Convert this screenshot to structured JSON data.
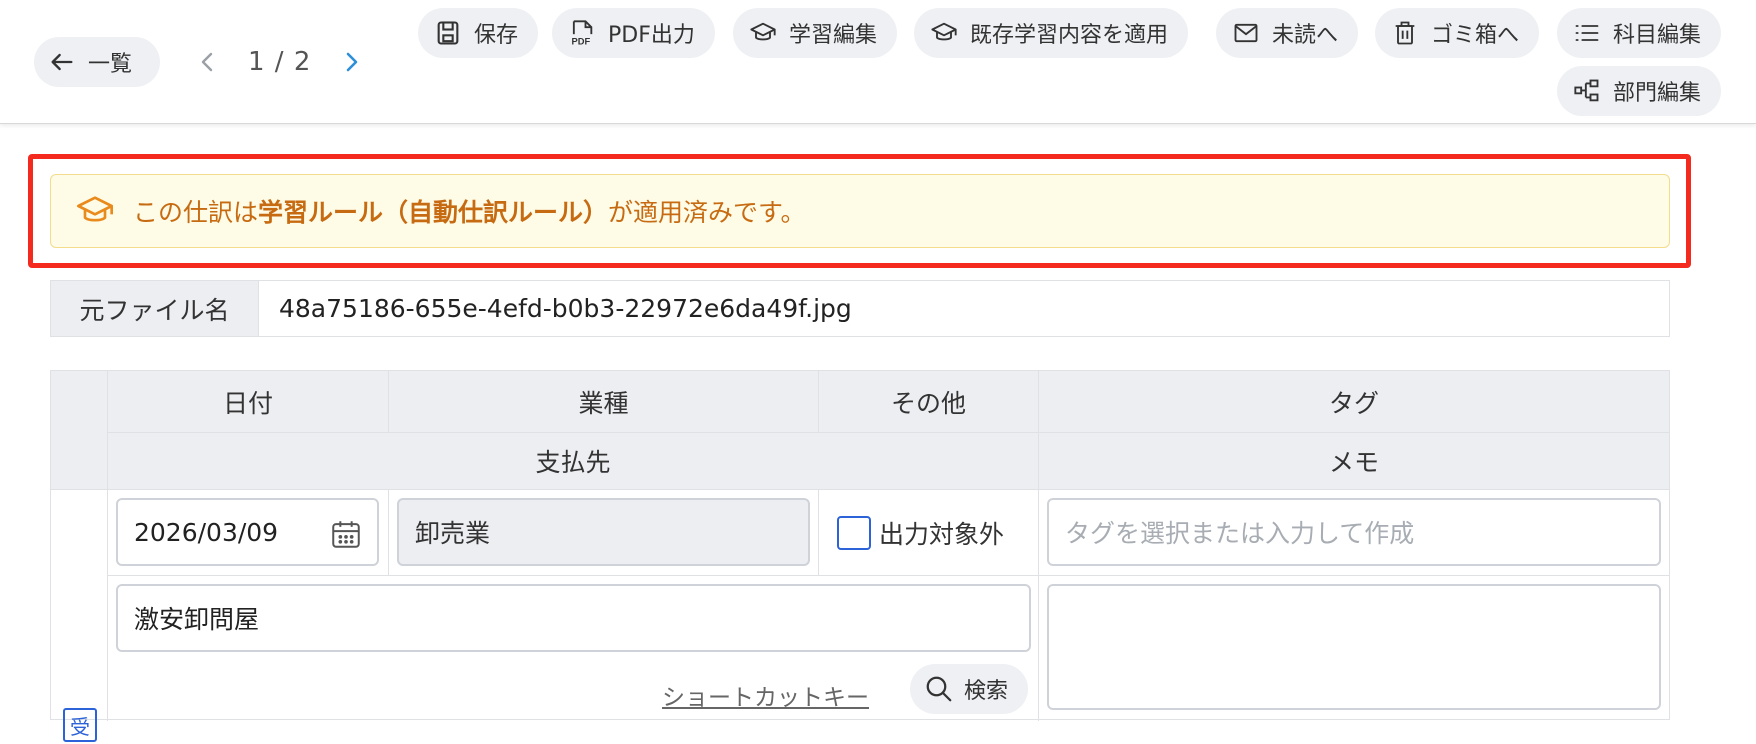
{
  "toolbar": {
    "back_label": "一覧",
    "pager": {
      "current": 1,
      "total": 2,
      "text": "1 / 2"
    },
    "actions": [
      {
        "label": "保存",
        "icon": "save-icon"
      },
      {
        "label": "PDF出力",
        "icon": "pdf-icon"
      },
      {
        "label": "学習編集",
        "icon": "graduation-cap-icon"
      },
      {
        "label": "既存学習内容を適用",
        "icon": "graduation-cap-icon"
      },
      {
        "label": "未読へ",
        "icon": "mail-icon"
      },
      {
        "label": "ゴミ箱へ",
        "icon": "trash-icon"
      },
      {
        "label": "科目編集",
        "icon": "list-icon"
      },
      {
        "label": "部門編集",
        "icon": "hierarchy-icon"
      }
    ]
  },
  "notice": {
    "prefix": "この仕訳は",
    "emphasis": "学習ルール（自動仕訳ルール）",
    "suffix": "が適用済みです。",
    "color": "#c76b12",
    "background": "#fefbe6",
    "highlight_color": "#f42a1f"
  },
  "file": {
    "label": "元ファイル名",
    "value": "48a75186-655e-4efd-b0b3-22972e6da49f.jpg"
  },
  "grid": {
    "headers_row1": {
      "date": "日付",
      "industry": "業種",
      "other": "その他",
      "tags": "タグ"
    },
    "headers_row2": {
      "payee": "支払先",
      "memo": "メモ"
    },
    "entry": {
      "badge": "受",
      "date_value": "2026/03/09",
      "industry_value": "卸売業",
      "exclude_label": "出力対象外",
      "exclude_checked": false,
      "tags_placeholder": "タグを選択または入力して作成",
      "payee_value": "激安卸問屋",
      "memo_value": "",
      "shortcut_label": "ショートカットキー",
      "search_label": "検索"
    }
  },
  "colors": {
    "accent_blue": "#2d63d8",
    "header_bg": "#eceef2",
    "pill_bg": "#eef0f3"
  }
}
